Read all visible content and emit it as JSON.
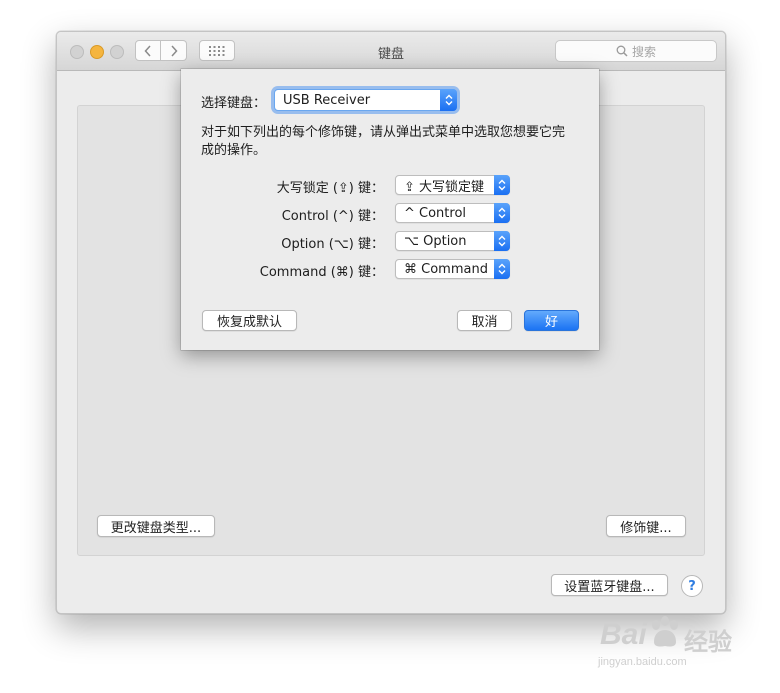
{
  "window": {
    "title": "键盘"
  },
  "search": {
    "placeholder": "搜索"
  },
  "main": {
    "change_type_label": "更改键盘类型...",
    "modifier_keys_label": "修饰键...",
    "bluetooth_setup_label": "设置蓝牙键盘...",
    "help_label": "?"
  },
  "sheet": {
    "select_keyboard_label": "选择键盘：",
    "selected_keyboard": "USB Receiver",
    "instructions_line1": "对于如下列出的每个修饰键，请从弹出式菜单中选取您想要它完",
    "instructions_line2": "成的操作。",
    "rows": [
      {
        "label": "大写锁定 (⇪) 键：",
        "value": "⇪ 大写锁定键"
      },
      {
        "label": "Control (^) 键：",
        "value": "^ Control"
      },
      {
        "label": "Option (⌥) 键：",
        "value": "⌥ Option"
      },
      {
        "label": "Command (⌘) 键：",
        "value": "⌘ Command"
      }
    ],
    "restore_defaults_label": "恢复成默认",
    "cancel_label": "取消",
    "ok_label": "好"
  },
  "watermark": {
    "brand": "Bai",
    "brand_cn": "经验",
    "url": "jingyan.baidu.com"
  },
  "colors": {
    "accent": "#1b73f3",
    "window_bg": "#ececec",
    "minimize": "#f5b53f"
  },
  "icons": [
    "chevron-left-icon",
    "chevron-right-icon",
    "grid-icon",
    "search-icon",
    "updown-arrows-icon",
    "paw-icon"
  ]
}
